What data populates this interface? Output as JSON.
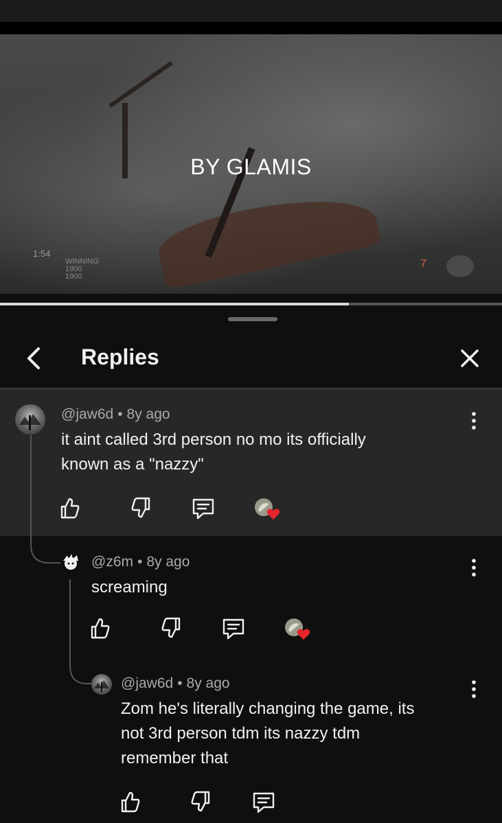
{
  "video": {
    "overlay_text": "BY GLAMIS",
    "hud_time": "1:54",
    "hud_score": [
      "WINNING",
      "1900",
      "1900"
    ],
    "hud_ammo": "7",
    "progress_fraction": 0.695
  },
  "sheet": {
    "title": "Replies",
    "back_icon": "chevron-left-icon",
    "close_icon": "close-icon"
  },
  "comments": [
    {
      "author": "@jaw6d",
      "age": "8y ago",
      "text_lines": [
        "it aint called 3rd person no mo its officially",
        "known as a \"nazzy\""
      ],
      "creator_heart": true
    },
    {
      "author": "@z6m",
      "age": "8y ago",
      "text_lines": [
        "screaming"
      ],
      "creator_heart": true
    },
    {
      "author": "@jaw6d",
      "age": "8y ago",
      "text_lines": [
        "Zom he's literally changing the game, its",
        "not 3rd person tdm its nazzy tdm",
        "remember that"
      ],
      "creator_heart": false
    }
  ],
  "colors": {
    "background": "#0f0f0f",
    "highlight": "#272727",
    "heart": "#e5242b",
    "meta_text": "#aaaaaa"
  }
}
